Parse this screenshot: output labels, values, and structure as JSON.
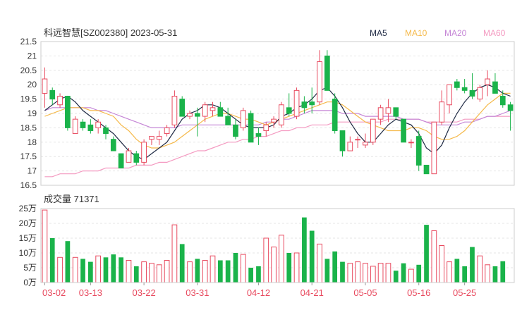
{
  "chart_data": [
    {
      "type": "candlestick",
      "title": "科远智慧[SZ002380] 2023-05-31",
      "ylim": [
        16.5,
        21.5
      ],
      "y_ticks": [
        "21.5",
        "21",
        "20.5",
        "20",
        "19.5",
        "19",
        "18.5",
        "18",
        "17.5",
        "17",
        "16.5"
      ],
      "y_tick_values": [
        21.5,
        21,
        20.5,
        20,
        19.5,
        19,
        18.5,
        18,
        17.5,
        17,
        16.5
      ],
      "grid": true,
      "legend_position": "top-right",
      "legend": [
        {
          "name": "MA5",
          "color": "#1f2a44"
        },
        {
          "name": "MA10",
          "color": "#f5b94a"
        },
        {
          "name": "MA20",
          "color": "#c586d6"
        },
        {
          "name": "MA60",
          "color": "#f49ac1"
        }
      ],
      "up_color": "#e84a5f",
      "down_color": "#1ab34a",
      "candles": [
        [
          19.7,
          20.6,
          19.2,
          20.2
        ],
        [
          19.8,
          19.9,
          19.3,
          19.5
        ],
        [
          19.3,
          19.7,
          19.2,
          19.6
        ],
        [
          19.6,
          19.6,
          18.4,
          18.5
        ],
        [
          18.3,
          18.9,
          18.3,
          18.8
        ],
        [
          18.7,
          18.8,
          18.4,
          18.5
        ],
        [
          18.6,
          18.8,
          18.3,
          18.4
        ],
        [
          18.5,
          18.8,
          18.3,
          18.7
        ],
        [
          18.5,
          18.6,
          18.1,
          18.3
        ],
        [
          18.1,
          18.2,
          17.7,
          17.7
        ],
        [
          17.6,
          17.6,
          17.1,
          17.1
        ],
        [
          17.3,
          17.8,
          17.3,
          17.7
        ],
        [
          17.6,
          17.7,
          17.2,
          17.3
        ],
        [
          17.3,
          18.1,
          17.2,
          18.0
        ],
        [
          18.1,
          18.2,
          17.9,
          18.2
        ],
        [
          18.1,
          18.4,
          17.9,
          18.2
        ],
        [
          18.3,
          18.6,
          18.2,
          18.5
        ],
        [
          18.6,
          19.8,
          18.5,
          19.6
        ],
        [
          19.5,
          19.6,
          18.9,
          18.9
        ],
        [
          18.9,
          19.1,
          18.8,
          19.0
        ],
        [
          19.0,
          19.2,
          18.2,
          18.9
        ],
        [
          18.9,
          19.4,
          18.7,
          19.3
        ],
        [
          19.1,
          19.4,
          18.9,
          19.2
        ],
        [
          19.2,
          19.4,
          18.9,
          18.9
        ],
        [
          18.9,
          19.2,
          18.6,
          18.6
        ],
        [
          18.6,
          18.8,
          18.1,
          18.2
        ],
        [
          18.5,
          19.2,
          18.4,
          19.1
        ],
        [
          19.0,
          19.1,
          18.3,
          18.0
        ],
        [
          18.3,
          18.5,
          17.9,
          18.2
        ],
        [
          18.4,
          18.7,
          18.2,
          18.6
        ],
        [
          18.7,
          18.9,
          18.5,
          18.8
        ],
        [
          18.6,
          19.4,
          18.5,
          19.3
        ],
        [
          19.2,
          19.7,
          18.9,
          19.0
        ],
        [
          18.9,
          19.9,
          18.8,
          19.8
        ],
        [
          19.4,
          19.6,
          19.0,
          19.2
        ],
        [
          19.4,
          19.9,
          19.0,
          19.3
        ],
        [
          19.4,
          21.2,
          19.3,
          20.8
        ],
        [
          21.0,
          21.2,
          20.0,
          19.8
        ],
        [
          19.5,
          19.7,
          18.3,
          18.4
        ],
        [
          18.4,
          18.4,
          17.5,
          17.7
        ],
        [
          17.7,
          18.2,
          17.7,
          18.0
        ],
        [
          18.1,
          18.2,
          17.8,
          18.1
        ],
        [
          17.9,
          18.3,
          17.8,
          18.0
        ],
        [
          18.0,
          18.8,
          17.9,
          18.8
        ],
        [
          18.8,
          19.3,
          18.6,
          19.2
        ],
        [
          19.0,
          19.5,
          18.7,
          19.2
        ],
        [
          19.2,
          19.2,
          18.8,
          18.9
        ],
        [
          18.8,
          18.8,
          18.0,
          18.0
        ],
        [
          18.0,
          18.1,
          17.8,
          18.0
        ],
        [
          18.2,
          18.4,
          17.0,
          17.2
        ],
        [
          17.2,
          17.2,
          16.9,
          16.9
        ],
        [
          16.9,
          18.7,
          16.9,
          18.7
        ],
        [
          18.7,
          19.8,
          18.6,
          19.4
        ],
        [
          19.3,
          20.0,
          19.0,
          20.0
        ],
        [
          20.1,
          20.2,
          19.8,
          19.9
        ],
        [
          19.9,
          20.2,
          19.7,
          19.8
        ],
        [
          19.8,
          20.4,
          19.5,
          19.6
        ],
        [
          19.5,
          20.0,
          19.4,
          19.9
        ],
        [
          20.0,
          20.5,
          19.6,
          20.2
        ],
        [
          20.1,
          20.4,
          19.8,
          19.7
        ],
        [
          19.6,
          19.8,
          19.2,
          19.3
        ],
        [
          19.3,
          19.4,
          18.4,
          19.1
        ]
      ],
      "ma5": [
        19.1,
        19.3,
        19.5,
        19.6,
        19.4,
        19.1,
        18.9,
        18.7,
        18.5,
        18.3,
        18.0,
        17.7,
        17.5,
        17.4,
        17.6,
        17.8,
        18.0,
        18.4,
        18.8,
        19.0,
        19.1,
        19.3,
        19.3,
        19.2,
        19.0,
        18.8,
        18.6,
        18.5,
        18.5,
        18.5,
        18.6,
        18.9,
        19.0,
        19.2,
        19.3,
        19.5,
        19.8,
        19.9,
        19.6,
        19.2,
        18.7,
        18.3,
        18.0,
        18.0,
        18.3,
        18.6,
        18.8,
        18.7,
        18.6,
        18.3,
        17.8,
        17.6,
        17.9,
        18.5,
        19.0,
        19.4,
        19.7,
        19.9,
        20.0,
        19.9,
        19.7,
        19.6
      ],
      "ma10": [
        18.9,
        19.0,
        19.1,
        19.2,
        19.2,
        19.2,
        19.1,
        19.1,
        19.0,
        18.9,
        18.6,
        18.4,
        18.1,
        17.9,
        17.8,
        17.8,
        17.9,
        18.0,
        18.2,
        18.4,
        18.6,
        18.8,
        18.9,
        19.0,
        19.0,
        18.9,
        18.8,
        18.8,
        18.7,
        18.6,
        18.7,
        18.8,
        18.9,
        19.0,
        19.1,
        19.2,
        19.3,
        19.4,
        19.4,
        19.3,
        19.1,
        18.9,
        18.7,
        18.6,
        18.5,
        18.4,
        18.4,
        18.4,
        18.5,
        18.5,
        18.4,
        18.2,
        18.1,
        18.1,
        18.2,
        18.4,
        18.7,
        19.0,
        19.3,
        19.5,
        19.7,
        19.7
      ],
      "ma20": [
        19.1,
        19.2,
        19.2,
        19.2,
        19.2,
        19.2,
        19.2,
        19.1,
        19.1,
        19.0,
        18.9,
        18.8,
        18.7,
        18.6,
        18.5,
        18.5,
        18.5,
        18.5,
        18.6,
        18.6,
        18.6,
        18.6,
        18.6,
        18.6,
        18.6,
        18.6,
        18.6,
        18.6,
        18.6,
        18.7,
        18.7,
        18.8,
        18.8,
        18.9,
        19.0,
        19.1,
        19.1,
        19.1,
        19.1,
        19.0,
        19.0,
        19.0,
        18.9,
        18.9,
        18.9,
        18.9,
        18.9,
        18.8,
        18.8,
        18.8,
        18.7,
        18.6,
        18.6,
        18.6,
        18.6,
        18.7,
        18.7,
        18.8,
        18.9,
        18.9,
        19.0,
        19.1
      ],
      "ma60": [
        16.8,
        16.8,
        16.9,
        16.9,
        16.9,
        17.0,
        17.0,
        17.0,
        17.1,
        17.1,
        17.1,
        17.1,
        17.2,
        17.2,
        17.2,
        17.3,
        17.3,
        17.4,
        17.5,
        17.6,
        17.7,
        17.7,
        17.8,
        17.9,
        18.0,
        18.0,
        18.1,
        18.1,
        18.2,
        18.2,
        18.3,
        18.4,
        18.4,
        18.5,
        18.5,
        18.6,
        18.6,
        18.6,
        18.7,
        18.7,
        18.7,
        18.7,
        18.7,
        18.7,
        18.7,
        18.8,
        18.8,
        18.8,
        18.8,
        18.8,
        18.7,
        18.7,
        18.7,
        18.7,
        18.7,
        18.8,
        18.8,
        18.8,
        18.9,
        18.9,
        18.9,
        18.9
      ]
    },
    {
      "type": "bar",
      "title": "成交量 71371",
      "ylim": [
        0,
        25
      ],
      "y_ticks": [
        "25万",
        "20万",
        "15万",
        "10万",
        "5万",
        "0万"
      ],
      "y_tick_values": [
        25,
        20,
        15,
        10,
        5,
        0
      ],
      "x_ticks": [
        "03-02",
        "03-13",
        "03-22",
        "03-31",
        "04-12",
        "04-21",
        "05-05",
        "05-16",
        "05-25"
      ],
      "x_tick_index": [
        0,
        6,
        13,
        20,
        28,
        35,
        42,
        49,
        55
      ],
      "values": [
        24.5,
        15,
        8.5,
        14,
        8.5,
        8,
        7,
        9,
        8.5,
        9.5,
        8.5,
        7.5,
        5.5,
        7,
        6.5,
        6,
        7.5,
        19.5,
        13,
        7,
        8,
        7.5,
        9,
        7.5,
        7.5,
        10,
        9.5,
        5,
        5.5,
        15,
        12,
        16,
        10,
        10,
        22,
        17.5,
        13,
        8,
        10.5,
        7,
        6.5,
        7,
        6.5,
        5.5,
        6.5,
        6.5,
        4,
        6.5,
        4.5,
        6,
        19.5,
        17.5,
        12.5,
        7,
        8,
        5.5,
        12,
        9,
        6,
        5.5,
        7.2,
        0
      ]
    }
  ]
}
